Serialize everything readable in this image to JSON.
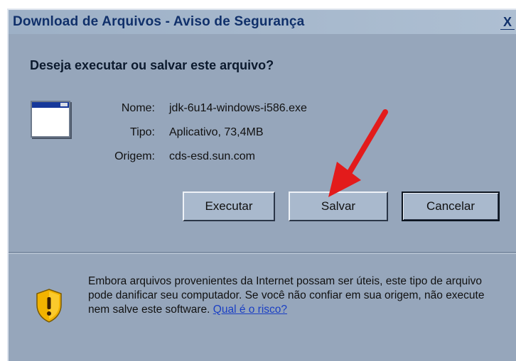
{
  "window": {
    "title": "Download de Arquivos - Aviso de Segurança",
    "close_label": "X"
  },
  "dialog": {
    "question": "Deseja executar ou salvar este arquivo?",
    "file": {
      "name_label": "Nome:",
      "name_value": "jdk-6u14-windows-i586.exe",
      "type_label": "Tipo:",
      "type_value": "Aplicativo, 73,4MB",
      "origin_label": "Origem:",
      "origin_value": "cds-esd.sun.com"
    },
    "buttons": {
      "run_label": "Executar",
      "save_label": "Salvar",
      "cancel_label": "Cancelar"
    },
    "warning": {
      "text": "Embora arquivos provenientes da Internet possam ser úteis, este tipo de arquivo pode danificar seu computador. Se você não confiar em sua origem, não execute nem salve este software.",
      "link_text": "Qual é o risco?"
    }
  },
  "icons": {
    "file": "application-window-icon",
    "warning": "security-shield-icon",
    "annotation": "red-arrow-pointer"
  },
  "colors": {
    "window_background": "#96a6bb",
    "title_text": "#10306a",
    "link": "#1a3fc4",
    "arrow": "#e31b1b",
    "shield": "#f2b300"
  }
}
